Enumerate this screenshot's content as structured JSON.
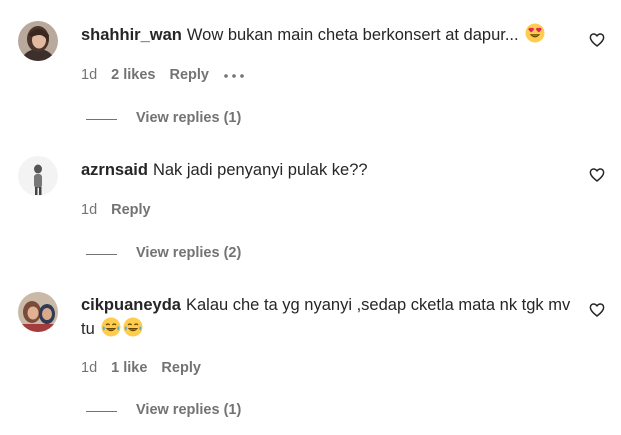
{
  "colors": {
    "text": "#262626",
    "secondary": "#737373",
    "background": "#ffffff",
    "emoji_yellow": "#FFCC4D"
  },
  "comments": [
    {
      "username": "shahhir_wan",
      "text": "Wow bukan main cheta berkonsert at dapur...",
      "emoji": [
        "heart-eyes-emoji"
      ],
      "time": "1d",
      "likes": "2 likes",
      "reply_label": "Reply",
      "more_icon": "ellipsis-icon",
      "view_replies": "View replies (1)",
      "like_icon": "heart-outline-icon"
    },
    {
      "username": "azrnsaid",
      "text": "Nak jadi penyanyi pulak ke??",
      "emoji": [],
      "time": "1d",
      "reply_label": "Reply",
      "view_replies": "View replies (2)",
      "like_icon": "heart-outline-icon"
    },
    {
      "username": "cikpuaneyda",
      "text": "Kalau che ta yg nyanyi ,sedap cketla mata nk tgk mv tu",
      "emoji": [
        "tears-of-joy-emoji",
        "tears-of-joy-emoji"
      ],
      "time": "1d",
      "likes": "1 like",
      "reply_label": "Reply",
      "view_replies": "View replies (1)",
      "like_icon": "heart-outline-icon"
    }
  ]
}
